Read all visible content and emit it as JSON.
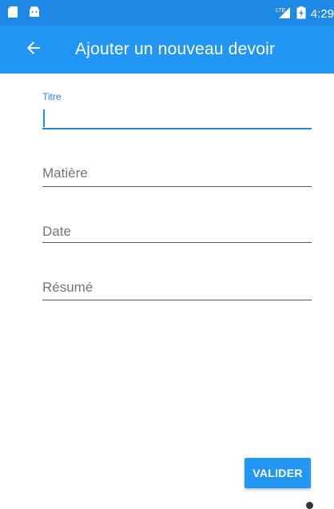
{
  "status_bar": {
    "left_icons": [
      "sd-card-icon",
      "android-icon"
    ],
    "network_label": "LTE",
    "time": "4:29",
    "color": "#1e88e5"
  },
  "app_bar": {
    "title": "Ajouter un nouveau devoir",
    "back_icon": "arrow-back-icon",
    "color": "#2196f3"
  },
  "form": {
    "titre": {
      "label": "Titre",
      "value": ""
    },
    "matiere": {
      "placeholder": "Matière",
      "value": ""
    },
    "date": {
      "placeholder": "Date",
      "value": ""
    },
    "resume": {
      "placeholder": "Résumé",
      "value": ""
    }
  },
  "actions": {
    "submit_label": "VALIDER"
  },
  "colors": {
    "accent": "#1e88e5",
    "text_hint": "#757575",
    "underline": "#5a5a5a"
  }
}
